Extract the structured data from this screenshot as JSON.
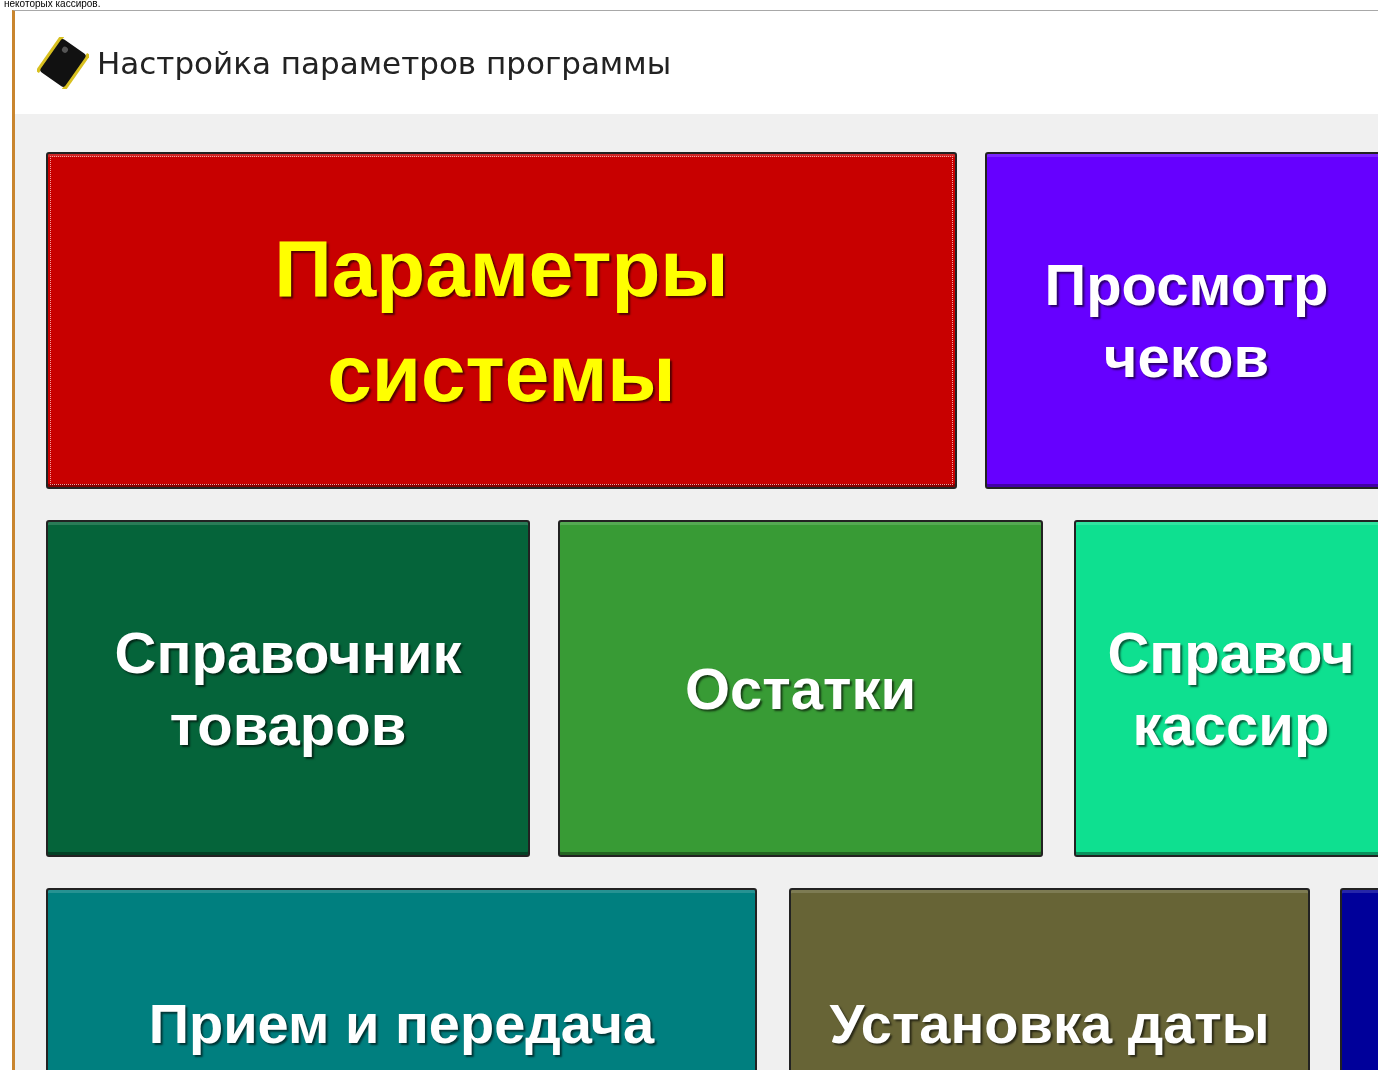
{
  "top_text": "некоторых кассиров.",
  "window": {
    "title": "Настройка параметров программы"
  },
  "rows": [
    [
      {
        "lines": [
          "Параметры",
          "системы"
        ],
        "color": "#c80000",
        "selected": true
      },
      {
        "lines": [
          "Просмотр",
          "чеков"
        ],
        "color": "#6600ff",
        "selected": false
      }
    ],
    [
      {
        "lines": [
          "Справочник",
          "товаров"
        ],
        "color": "#05643a",
        "selected": false
      },
      {
        "lines": [
          "Остатки"
        ],
        "color": "#389b35",
        "selected": false
      },
      {
        "lines": [
          "Справоч",
          "кассир"
        ],
        "color": "#0ee090",
        "selected": false
      }
    ],
    [
      {
        "lines": [
          "Прием и передача"
        ],
        "color": "#007f7f",
        "selected": false
      },
      {
        "lines": [
          "Установка даты"
        ],
        "color": "#676436",
        "selected": false
      },
      {
        "color": "#00009a",
        "selected": false
      }
    ]
  ]
}
